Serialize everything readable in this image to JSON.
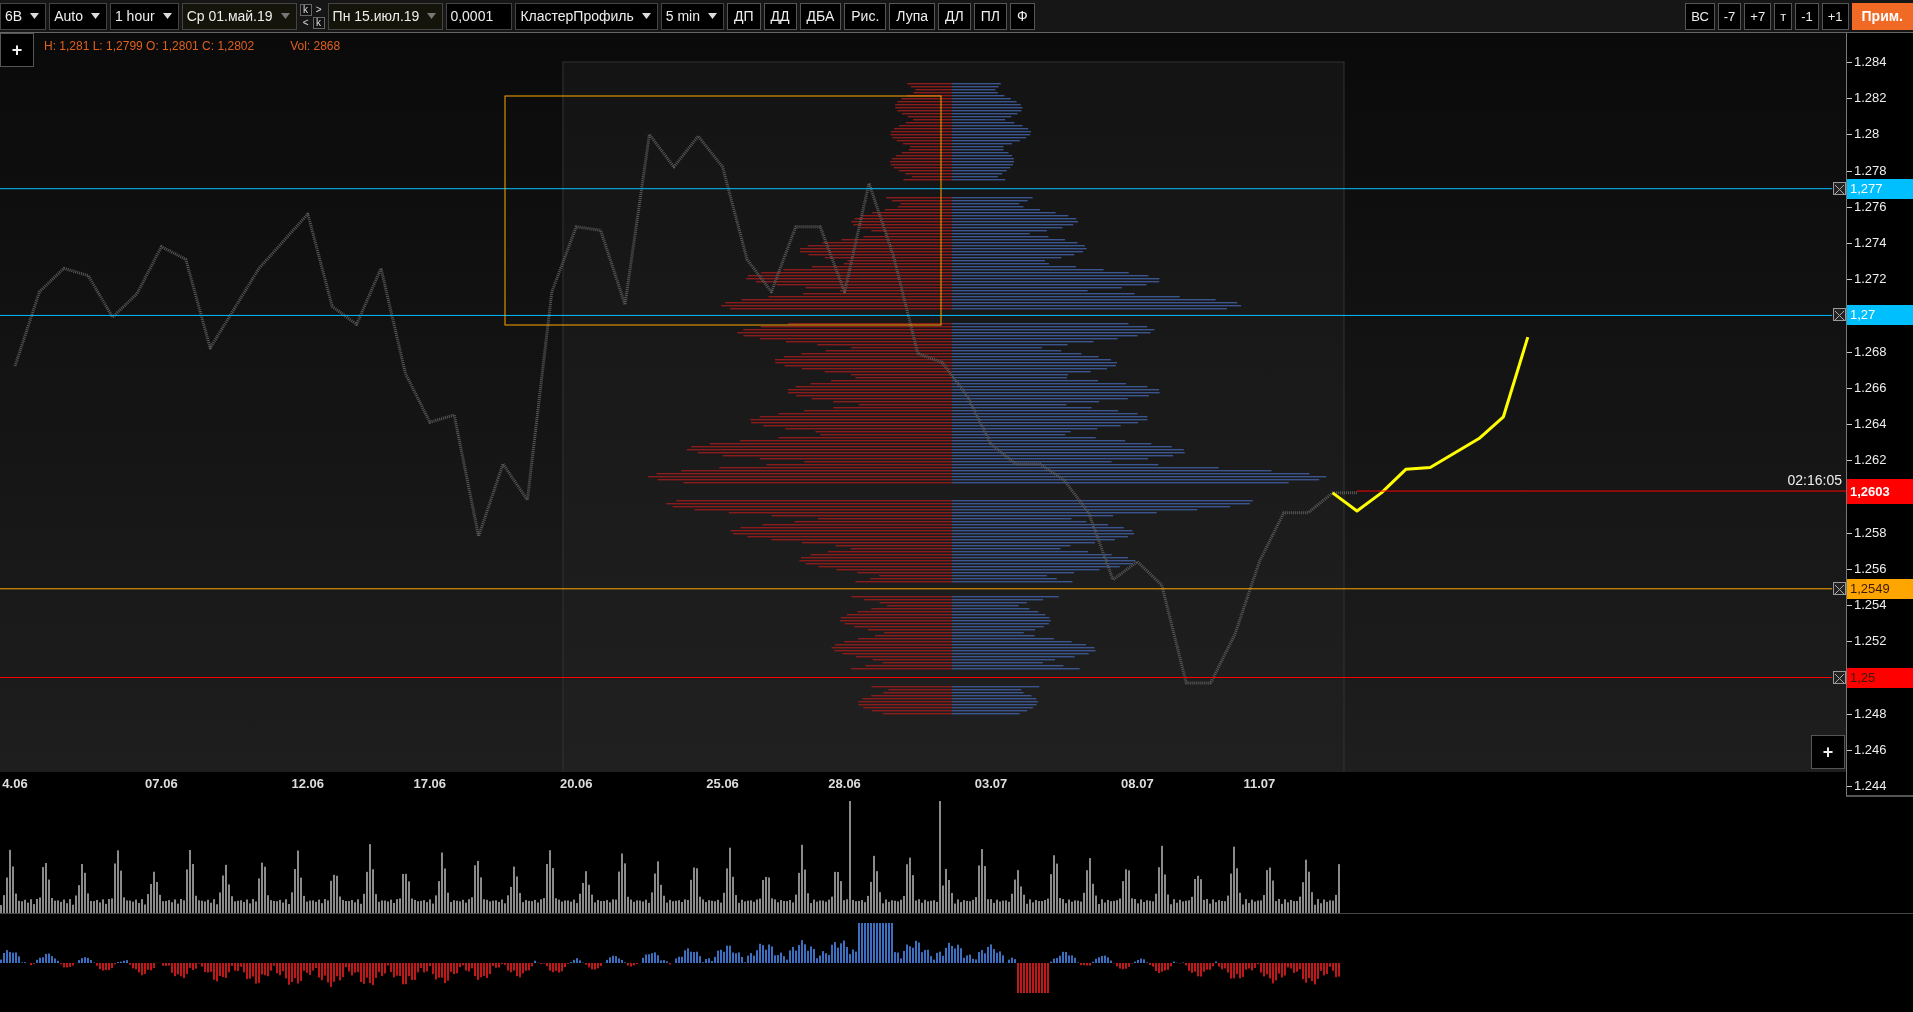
{
  "toolbar": {
    "left": [
      {
        "kind": "dropdown",
        "label": "6В"
      },
      {
        "kind": "dropdown",
        "label": "Auto"
      },
      {
        "kind": "dropdown",
        "label": "1 hour"
      },
      {
        "kind": "date",
        "label": "Ср 01.май.19"
      },
      {
        "kind": "stepper",
        "keys": [
          "k",
          ">",
          "<",
          "k"
        ]
      },
      {
        "kind": "date",
        "label": "Пн 15.июл.19"
      },
      {
        "kind": "field",
        "label": "0,0001"
      },
      {
        "kind": "dropdown",
        "label": "КластерПрофиль"
      },
      {
        "kind": "dropdown",
        "label": "5 min"
      },
      {
        "kind": "button",
        "label": "ДП"
      },
      {
        "kind": "button",
        "label": "ДД"
      },
      {
        "kind": "button",
        "label": "ДБА"
      },
      {
        "kind": "button",
        "label": "Рис."
      },
      {
        "kind": "button",
        "label": "Лупа"
      },
      {
        "kind": "button",
        "label": "ДЛ"
      },
      {
        "kind": "button",
        "label": "ПЛ"
      },
      {
        "kind": "button",
        "label": "Ф"
      }
    ],
    "right": [
      {
        "kind": "button",
        "label": "ВС"
      },
      {
        "kind": "button",
        "label": "-7"
      },
      {
        "kind": "button",
        "label": "+7"
      },
      {
        "kind": "button",
        "label": "т"
      },
      {
        "kind": "button",
        "label": "-1"
      },
      {
        "kind": "button",
        "label": "+1"
      },
      {
        "kind": "accent",
        "label": "Прим."
      }
    ]
  },
  "info": {
    "ohlc": "H: 1,281 L: 1,2799 O: 1,2801 C: 1,2802",
    "volume": "Vol: 2868"
  },
  "chart": {
    "plus_buttons": [
      "+",
      "+"
    ],
    "timer": "02:16:05",
    "chart_data": {
      "type": "line",
      "ylim": [
        1.2434,
        1.2856
      ],
      "categories": [
        "4.06",
        null,
        null,
        null,
        null,
        null,
        "07.06",
        null,
        null,
        null,
        null,
        null,
        "12.06",
        null,
        null,
        null,
        null,
        "17.06",
        null,
        null,
        null,
        null,
        null,
        "20.06",
        null,
        null,
        null,
        null,
        null,
        "25.06",
        null,
        null,
        null,
        null,
        "28.06",
        null,
        null,
        null,
        null,
        null,
        "03.07",
        null,
        null,
        null,
        null,
        null,
        "08.07",
        null,
        null,
        null,
        null,
        "11.07",
        null,
        null,
        null,
        null,
        null,
        null,
        null,
        null,
        null,
        null,
        null
      ],
      "series": [
        {
          "color": "#5a5a5a",
          "line_style": "dashed",
          "values": [
            1.2672,
            1.2713,
            1.2726,
            1.2722,
            1.2699,
            1.2712,
            1.2738,
            1.2731,
            1.2682,
            1.2704,
            1.2726,
            1.2741,
            1.2756,
            1.2705,
            1.2695,
            1.2726,
            1.2668,
            1.2641,
            1.2645,
            1.2578,
            1.2618,
            1.2598,
            1.2713,
            1.2749,
            1.2747,
            1.2706,
            1.28,
            1.2782,
            1.2799,
            1.2782,
            1.2731,
            1.2713,
            1.2749,
            1.2749,
            1.2713,
            1.2773,
            1.2733,
            1.2679,
            1.2674,
            1.2656,
            1.2629,
            1.2618,
            1.2618,
            1.2609,
            1.2591,
            1.2554,
            1.2564,
            1.2551,
            1.2497,
            1.2497,
            1.2524,
            1.2564,
            1.2591,
            1.2591,
            1.2602,
            1.2602,
            null,
            null,
            null,
            null,
            null,
            null,
            null
          ]
        },
        {
          "color": "#ffff00",
          "line_style": "solid",
          "values": [
            null,
            null,
            null,
            null,
            null,
            null,
            null,
            null,
            null,
            null,
            null,
            null,
            null,
            null,
            null,
            null,
            null,
            null,
            null,
            null,
            null,
            null,
            null,
            null,
            null,
            null,
            null,
            null,
            null,
            null,
            null,
            null,
            null,
            null,
            null,
            null,
            null,
            null,
            null,
            null,
            null,
            null,
            null,
            null,
            null,
            null,
            null,
            null,
            null,
            null,
            null,
            null,
            null,
            null,
            1.2602,
            1.2592,
            1.2602,
            1.2615,
            1.2616,
            1.2624,
            1.2632,
            1.2644,
            1.2688
          ]
        }
      ],
      "yticks": [
        1.284,
        1.282,
        1.28,
        1.278,
        1.276,
        1.274,
        1.272,
        1.268,
        1.266,
        1.264,
        1.262,
        1.258,
        1.256,
        1.254,
        1.252,
        1.248,
        1.246,
        1.244
      ],
      "ref_lines": [
        {
          "axis": "y",
          "value": 1.277,
          "color": "#00bfff"
        },
        {
          "axis": "y",
          "value": 1.27,
          "color": "#00bfff"
        },
        {
          "axis": "y",
          "value": 1.2603,
          "color": "#ff0000"
        },
        {
          "axis": "y",
          "value": 1.2549,
          "color": "#ffa500"
        },
        {
          "axis": "y",
          "value": 1.25,
          "color": "#ff0000"
        }
      ]
    },
    "price_tags": [
      {
        "label": "1,277",
        "kind": "level"
      },
      {
        "label": "1,27",
        "kind": "level"
      },
      {
        "label": "1,2603",
        "kind": "current"
      },
      {
        "label": "1,2549",
        "kind": "alert"
      },
      {
        "label": "1,25",
        "kind": "alert"
      }
    ]
  }
}
